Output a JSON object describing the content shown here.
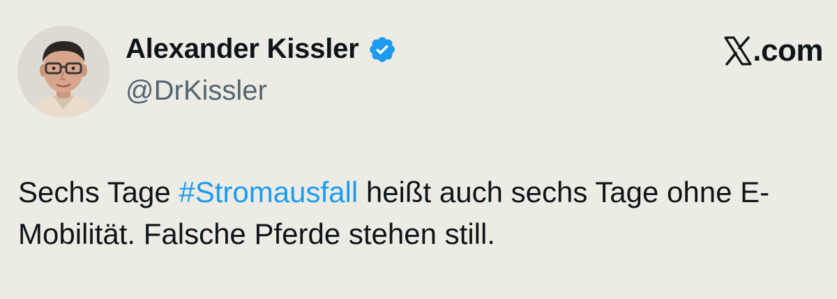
{
  "author": {
    "name": "Alexander Kissler",
    "handle": "@DrKissler",
    "verified": true,
    "avatar_icon": "profile-photo"
  },
  "brand": {
    "text": ".com",
    "icon": "x-logo-icon"
  },
  "tweet": {
    "part1": "Sechs Tage ",
    "hashtag": "#Stromausfall",
    "part2": " heißt auch sechs Tage ohne E-Mobilität. Falsche Pferde stehen still."
  },
  "colors": {
    "background": "#ecece5",
    "text": "#0f1419",
    "handle": "#536471",
    "hashtag": "#1d9bf0",
    "verified_badge": "#1d9bf0"
  }
}
